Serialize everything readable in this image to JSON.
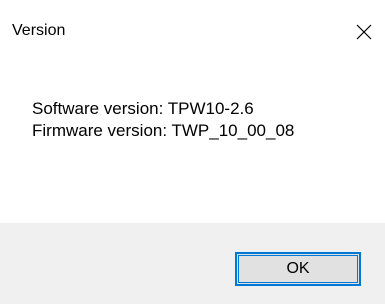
{
  "window": {
    "title": "Version",
    "close_icon": "close-icon"
  },
  "content": {
    "software_version": "Software version: TPW10-2.6",
    "firmware_version": "Firmware version: TWP_10_00_08"
  },
  "footer": {
    "ok_label": "OK"
  },
  "colors": {
    "accent": "#0078d7",
    "footer_bg": "#f0f0f0",
    "button_bg": "#e1e1e1"
  }
}
